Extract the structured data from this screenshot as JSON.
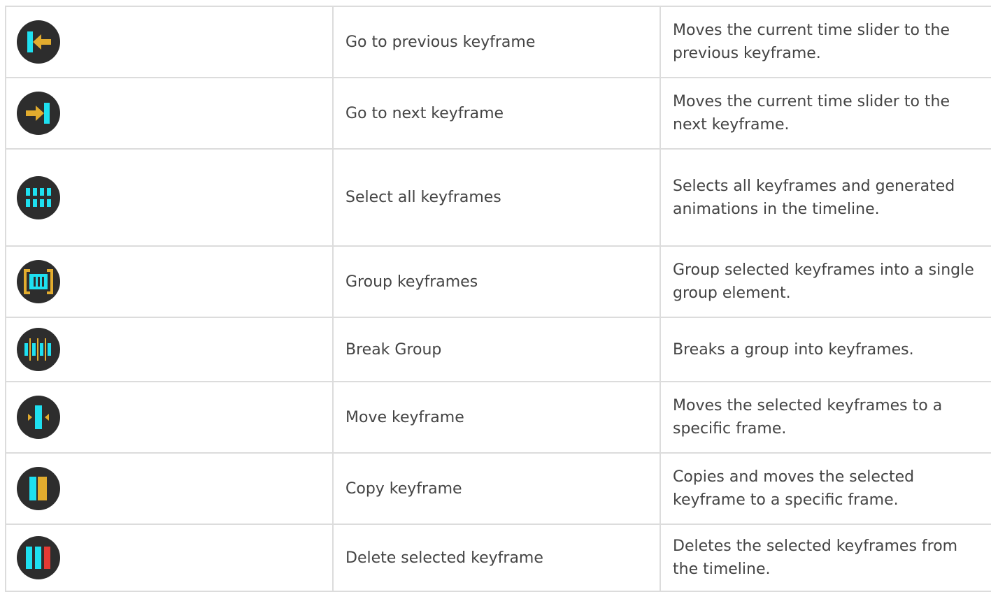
{
  "colors": {
    "icon_bg": "#2d2d2d",
    "cyan": "#1ee0f0",
    "gold": "#e2ac2e",
    "red": "#e43a34"
  },
  "rows": [
    {
      "icon": "previous-keyframe-icon",
      "name": "Go to previous keyframe",
      "description": "Moves the current time slider to the previous keyframe."
    },
    {
      "icon": "next-keyframe-icon",
      "name": "Go to next keyframe",
      "description": "Moves the current time slider to the next keyframe."
    },
    {
      "icon": "select-all-keyframes-icon",
      "name": "Select all keyframes",
      "description": "Selects all keyframes and generated animations in the timeline."
    },
    {
      "icon": "group-keyframes-icon",
      "name": "Group keyframes",
      "description": "Group selected keyframes into a single group element."
    },
    {
      "icon": "break-group-icon",
      "name": "Break Group",
      "description": "Breaks a group into keyframes."
    },
    {
      "icon": "move-keyframe-icon",
      "name": "Move keyframe",
      "description": "Moves the selected keyframes to a specific frame."
    },
    {
      "icon": "copy-keyframe-icon",
      "name": "Copy keyframe",
      "description": "Copies and moves the selected keyframe to a specific frame."
    },
    {
      "icon": "delete-keyframe-icon",
      "name": "Delete selected keyframe",
      "description": "Deletes the selected keyframes from the timeline."
    }
  ]
}
